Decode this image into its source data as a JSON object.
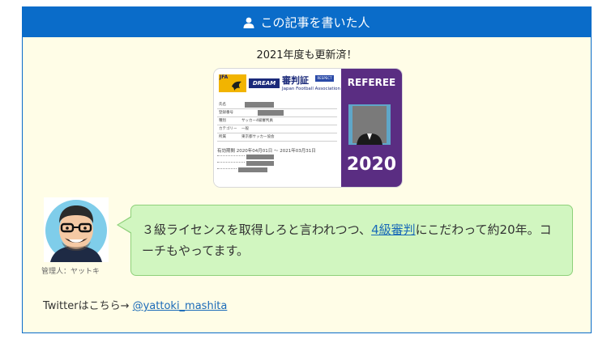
{
  "header": {
    "title": "この記事を書いた人",
    "icon": "user-icon"
  },
  "subtitle": "2021年度も更新済！",
  "card": {
    "jfa_label": "JFA",
    "dream_label": "DREAM",
    "title": "審判証",
    "org_name": "Japan Football Association",
    "respect_label": "RESPECT",
    "rows": [
      {
        "key": "氏名",
        "value": ""
      },
      {
        "key": "登録番号",
        "value": ""
      },
      {
        "key": "種別",
        "value": "サッカー4級審判員"
      },
      {
        "key": "カテゴリー",
        "value": "一般"
      },
      {
        "key": "所属",
        "value": "東京都サッカー協会"
      }
    ],
    "period": "有効期間 2020年04月01日 ～ 2021年03月31日",
    "referee_label": "REFEREE",
    "year": "2020"
  },
  "author": {
    "caption": "管理人：ヤットキ"
  },
  "bubble": {
    "text_before": "３級ライセンスを取得しろと言われつつ、",
    "link_text": "4級審判",
    "text_after": "にこだわって約20年。コーチもやってます。"
  },
  "twitter": {
    "label": "Twitterはこちら→ ",
    "handle": "@yattoki_mashita"
  },
  "colors": {
    "accent": "#0a6cc9",
    "box_bg": "#fffde7",
    "bubble_bg": "#d1f6c0",
    "link": "#1a6ab8"
  }
}
